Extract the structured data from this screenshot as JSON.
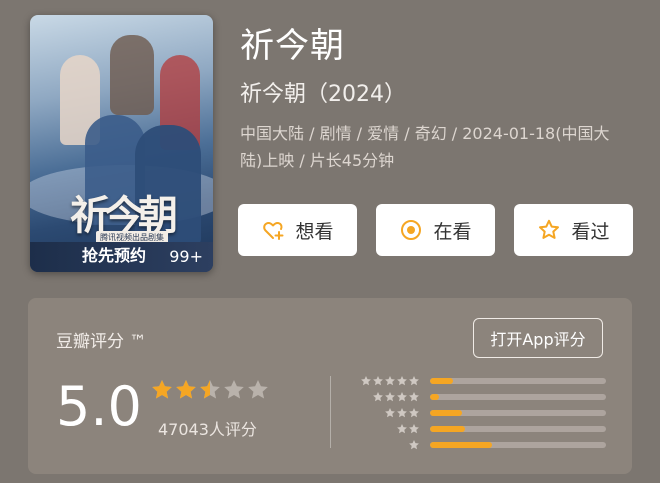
{
  "poster": {
    "calligraphy": "祈今朝",
    "tag": "腾讯视频出品剧集",
    "presale": "抢先预约",
    "count": "99+"
  },
  "movie": {
    "title": "祈今朝",
    "subtitle": "祈今朝（2024）",
    "meta": "中国大陆 / 剧情 / 爱情 / 奇幻 / 2024-01-18(中国大陆)上映 / 片长45分钟"
  },
  "actions": {
    "want": "想看",
    "watching": "在看",
    "watched": "看过"
  },
  "rating": {
    "label": "豆瓣评分 ™",
    "open_app": "打开App评分",
    "score": "5.0",
    "stars_value": 2.5,
    "votes": "47043人评分",
    "distribution": [
      {
        "stars": 5,
        "fraction": 0.13
      },
      {
        "stars": 4,
        "fraction": 0.05
      },
      {
        "stars": 3,
        "fraction": 0.18
      },
      {
        "stars": 2,
        "fraction": 0.2
      },
      {
        "stars": 1,
        "fraction": 0.35
      }
    ]
  },
  "colors": {
    "background": "#7c7670",
    "accent": "#f5a623",
    "star_empty": "#b9b2ab"
  }
}
